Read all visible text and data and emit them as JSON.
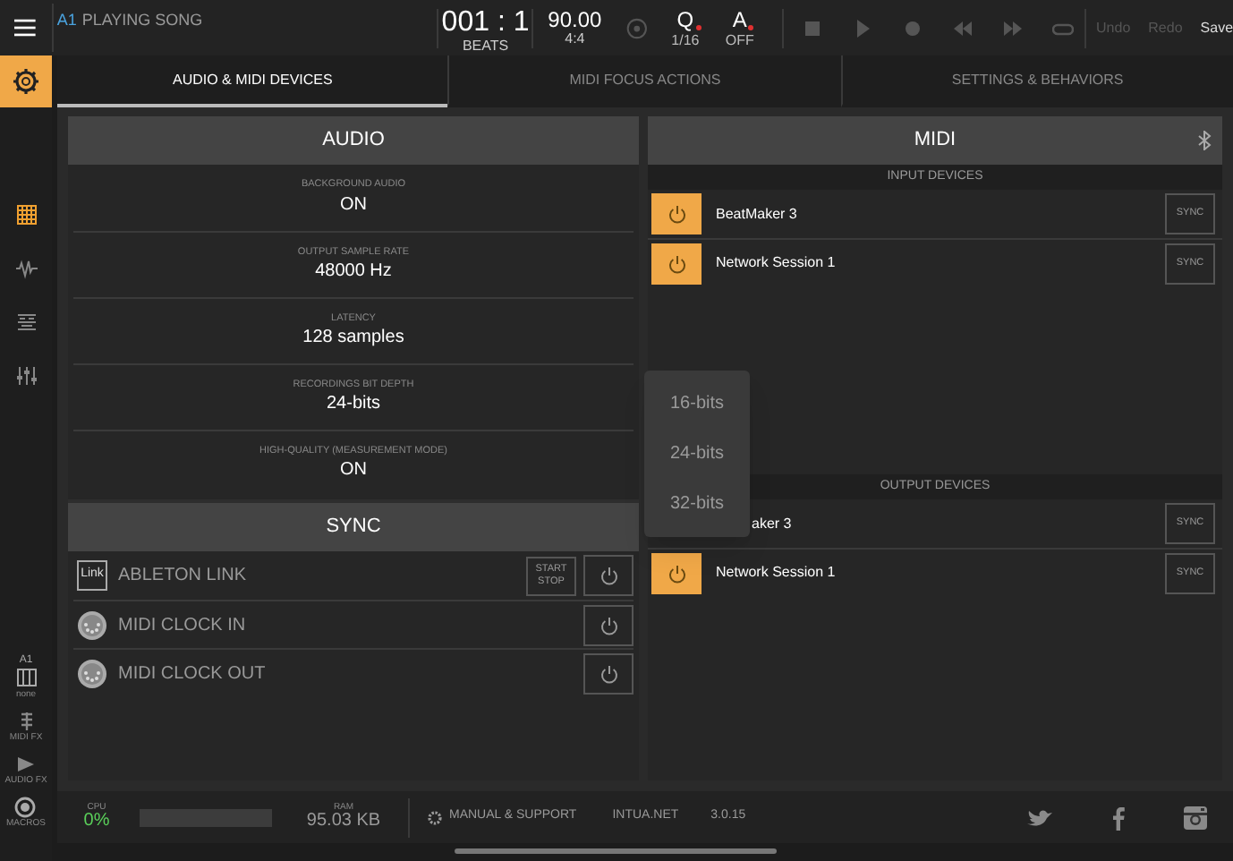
{
  "top_bar": {
    "track": "A1",
    "song_status": "PLAYING SONG",
    "position": "001 : 1",
    "position_label": "BEATS",
    "tempo": "90.00",
    "signature": "4:4",
    "quantize": {
      "label": "Q",
      "value": "1/16"
    },
    "auto": {
      "label": "A",
      "value": "OFF"
    },
    "undo": "Undo",
    "redo": "Redo",
    "save": "Save"
  },
  "tabs": [
    {
      "label": "AUDIO & MIDI DEVICES",
      "selected": true
    },
    {
      "label": "MIDI FOCUS ACTIONS",
      "selected": false
    },
    {
      "label": "SETTINGS & BEHAVIORS",
      "selected": false
    }
  ],
  "sidebar": {
    "views": [
      {
        "kind": "grid",
        "selected": true
      },
      {
        "kind": "wave",
        "selected": false
      },
      {
        "kind": "sequencer",
        "selected": false
      },
      {
        "kind": "mixer",
        "selected": false
      }
    ],
    "bottom": [
      {
        "kind": "piano",
        "top": "A1",
        "label": "none"
      },
      {
        "kind": "midifx",
        "label": "MIDI FX"
      },
      {
        "kind": "audiofx",
        "label": "AUDIO FX"
      },
      {
        "kind": "macros",
        "label": "MACROS"
      }
    ]
  },
  "audio": {
    "title": "AUDIO",
    "settings": [
      {
        "label": "BACKGROUND AUDIO",
        "value": "ON"
      },
      {
        "label": "OUTPUT SAMPLE RATE",
        "value": "48000 Hz"
      },
      {
        "label": "LATENCY",
        "value": "128 samples"
      },
      {
        "label": "RECORDINGS BIT DEPTH",
        "value": "24-bits"
      },
      {
        "label": "HIGH-QUALITY (MEASUREMENT MODE)",
        "value": "ON"
      }
    ]
  },
  "sync": {
    "title": "SYNC",
    "rows": [
      {
        "kind": "link",
        "icon_text": "Link",
        "label": "ABLETON LINK",
        "extra_button": "START STOP",
        "on": false
      },
      {
        "kind": "midi",
        "label": "MIDI CLOCK IN",
        "on": false
      },
      {
        "kind": "midi",
        "label": "MIDI CLOCK OUT",
        "on": false
      }
    ]
  },
  "midi": {
    "title": "MIDI",
    "input_title": "INPUT DEVICES",
    "inputs": [
      {
        "name": "BeatMaker 3",
        "on": true,
        "sync": "SYNC"
      },
      {
        "name": "Network Session 1",
        "on": true,
        "sync": "SYNC"
      }
    ],
    "output_title": "OUTPUT DEVICES",
    "outputs": [
      {
        "kind": "covered",
        "name": "aker 3",
        "sync": "SYNC"
      },
      {
        "kind": "device",
        "name": "Network Session 1",
        "on": true,
        "sync": "SYNC"
      }
    ]
  },
  "bit_depth_menu": [
    "16-bits",
    "24-bits",
    "32-bits"
  ],
  "footer": {
    "cpu_label": "CPU",
    "cpu": "0%",
    "ram_label": "RAM",
    "ram": "95.03 KB",
    "manual": "MANUAL & SUPPORT",
    "site": "INTUA.NET",
    "version": "3.0.15"
  }
}
